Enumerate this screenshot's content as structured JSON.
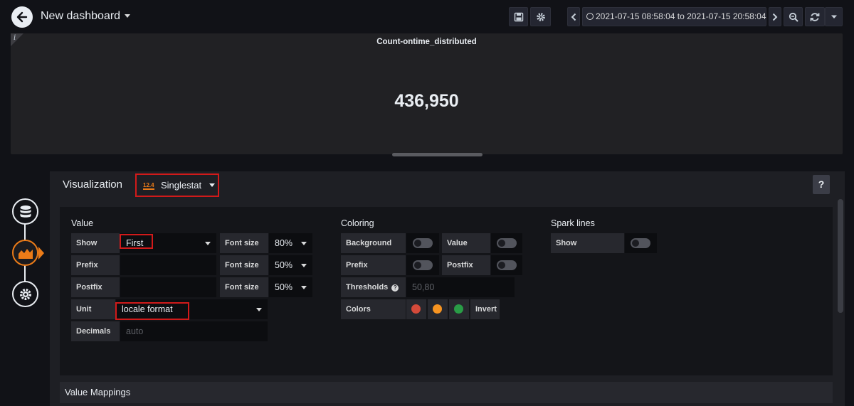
{
  "topbar": {
    "title": "New dashboard",
    "time_range": "2021-07-15 08:58:04 to 2021-07-15 20:58:04",
    "icons": [
      "back-icon",
      "save-icon",
      "gear-icon",
      "chevron-left-icon",
      "clock-icon",
      "chevron-right-icon",
      "zoom-out-icon",
      "refresh-icon",
      "chevron-down-icon"
    ]
  },
  "panel": {
    "title": "Count-ontime_distributed",
    "value": "436,950",
    "info_glyph": "i"
  },
  "editor": {
    "visualization_label": "Visualization",
    "visualization_badge": "12.4",
    "visualization_name": "Singlestat",
    "help": "?"
  },
  "value_section": {
    "title": "Value",
    "show_label": "Show",
    "show_value": "First",
    "prefix_label": "Prefix",
    "prefix_value": "",
    "postfix_label": "Postfix",
    "postfix_value": "",
    "unit_label": "Unit",
    "unit_value": "locale format",
    "decimals_label": "Decimals",
    "decimals_placeholder": "auto",
    "font_size_label": "Font size",
    "font_size_value": "80%",
    "prefix_font_size_value": "50%",
    "postfix_font_size_value": "50%"
  },
  "coloring": {
    "title": "Coloring",
    "background_label": "Background",
    "background_on": false,
    "value_label": "Value",
    "value_on": false,
    "prefix_label": "Prefix",
    "prefix_on": false,
    "postfix_label": "Postfix",
    "postfix_on": false,
    "thresholds_label": "Thresholds",
    "thresholds_placeholder": "50,80",
    "colors_label": "Colors",
    "colors": [
      "#d44a3a",
      "#f79421",
      "#299c46"
    ],
    "invert_label": "Invert"
  },
  "spark_lines": {
    "title": "Spark lines",
    "show_label": "Show",
    "show_on": false
  },
  "value_mappings": {
    "title": "Value Mappings"
  }
}
